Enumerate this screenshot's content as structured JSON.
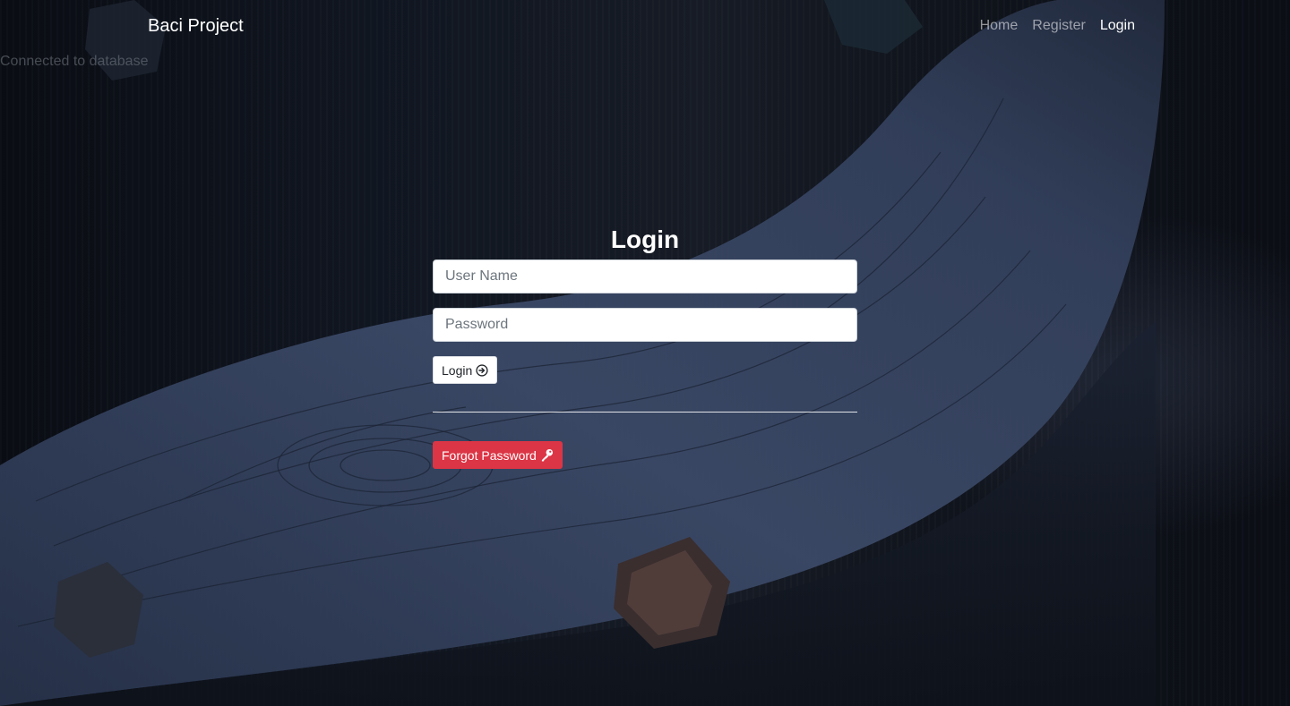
{
  "navbar": {
    "brand": "Baci Project",
    "links": [
      {
        "label": "Home",
        "active": false
      },
      {
        "label": "Register",
        "active": false
      },
      {
        "label": "Login",
        "active": true
      }
    ]
  },
  "status": {
    "message": "Connected to database"
  },
  "login_form": {
    "title": "Login",
    "username_placeholder": "User Name",
    "password_placeholder": "Password",
    "login_button": "Login",
    "login_icon": "arrow-right-circle-icon",
    "forgot_button": "Forgot Password",
    "forgot_icon": "key-icon"
  },
  "colors": {
    "danger": "#dc3545",
    "text_light": "#ffffff",
    "nav_muted": "rgba(255,255,255,0.55)"
  }
}
